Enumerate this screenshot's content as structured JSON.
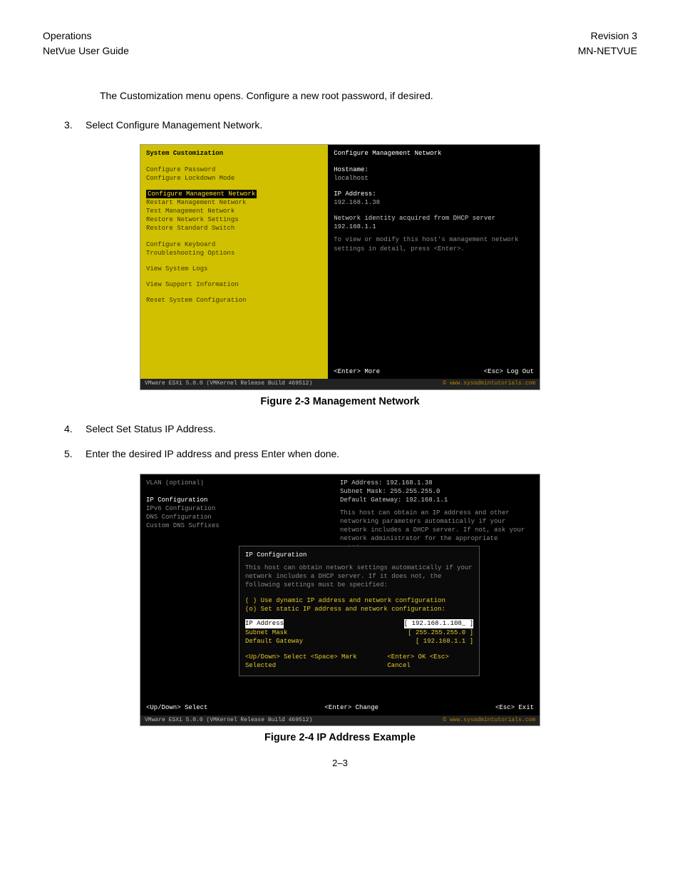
{
  "header": {
    "left1": "Operations",
    "left2": "NetVue User Guide",
    "right1": "Revision 3",
    "right2": "MN-NETVUE"
  },
  "body": {
    "intro": "The Customization menu opens. Configure a new root password, if desired.",
    "step3num": "3.",
    "step3": "Select Configure Management Network.",
    "step4num": "4.",
    "step4": "Select Set Status IP Address.",
    "step5num": "5.",
    "step5": "Enter the desired IP address and press Enter when done."
  },
  "fig1": {
    "caption": "Figure 2-3 Management Network",
    "left_title": "System Customization",
    "menu": {
      "g1": [
        "Configure Password",
        "Configure Lockdown Mode"
      ],
      "g2": [
        "Configure Management Network",
        "Restart Management Network",
        "Test Management Network",
        "Restore Network Settings",
        "Restore Standard Switch"
      ],
      "g3": [
        "Configure Keyboard",
        "Troubleshooting Options"
      ],
      "g4": [
        "View System Logs"
      ],
      "g5": [
        "View Support Information"
      ],
      "g6": [
        "Reset System Configuration"
      ]
    },
    "selected": "Configure Management Network",
    "right_title": "Configure Management Network",
    "hostname_lbl": "Hostname:",
    "hostname_val": "localhost",
    "ipaddr_lbl": "IP Address:",
    "ipaddr_val": "192.168.1.38",
    "identity": "Network identity acquired from DHCP server 192.168.1.1",
    "hint": "To view or modify this host's management network settings in detail, press <Enter>.",
    "enter_more": "<Enter> More",
    "esc_logout": "<Esc> Log Out",
    "vm_footer": "VMware ESXi 5.0.0 (VMKernel Release Build 469512)",
    "credit": "© www.sysadmintutorials.com"
  },
  "fig2": {
    "caption": "Figure 2-4 IP Address Example",
    "left_menu": [
      "VLAN (optional)",
      "",
      "IP Configuration",
      "IPv6 Configuration",
      "DNS Configuration",
      "Custom DNS Suffixes"
    ],
    "summary": {
      "ip": "IP Address: 192.168.1.38",
      "mask": "Subnet Mask: 255.255.255.0",
      "gw": "Default Gateway: 192.168.1.1",
      "text": "This host can obtain an IP address and other networking parameters automatically if your network includes a DHCP server. If not, ask your network administrator for the appropriate settings."
    },
    "dialog": {
      "title": "IP Configuration",
      "desc": "This host can obtain network settings automatically if your network includes a DHCP server. If it does not, the following settings must be specified:",
      "opt_dyn": "( ) Use dynamic IP address and network configuration",
      "opt_stat": "(o) Set static IP address and network configuration:",
      "rows": [
        {
          "lab": "IP Address",
          "val": "[ 192.168.1.108_  ]",
          "hi": true
        },
        {
          "lab": "Subnet Mask",
          "val": "[ 255.255.255.0   ]",
          "hi": false
        },
        {
          "lab": "Default Gateway",
          "val": "[ 192.168.1.1     ]",
          "hi": false
        }
      ],
      "hint_left": "<Up/Down> Select  <Space> Mark Selected",
      "hint_right": "<Enter> OK  <Esc> Cancel"
    },
    "bottom_left": "<Up/Down> Select",
    "bottom_mid": "<Enter> Change",
    "bottom_right": "<Esc> Exit",
    "vm_footer": "VMware ESXi 5.0.0 (VMKernel Release Build 469512)",
    "credit": "© www.sysadmintutorials.com"
  },
  "pageno": "2–3"
}
